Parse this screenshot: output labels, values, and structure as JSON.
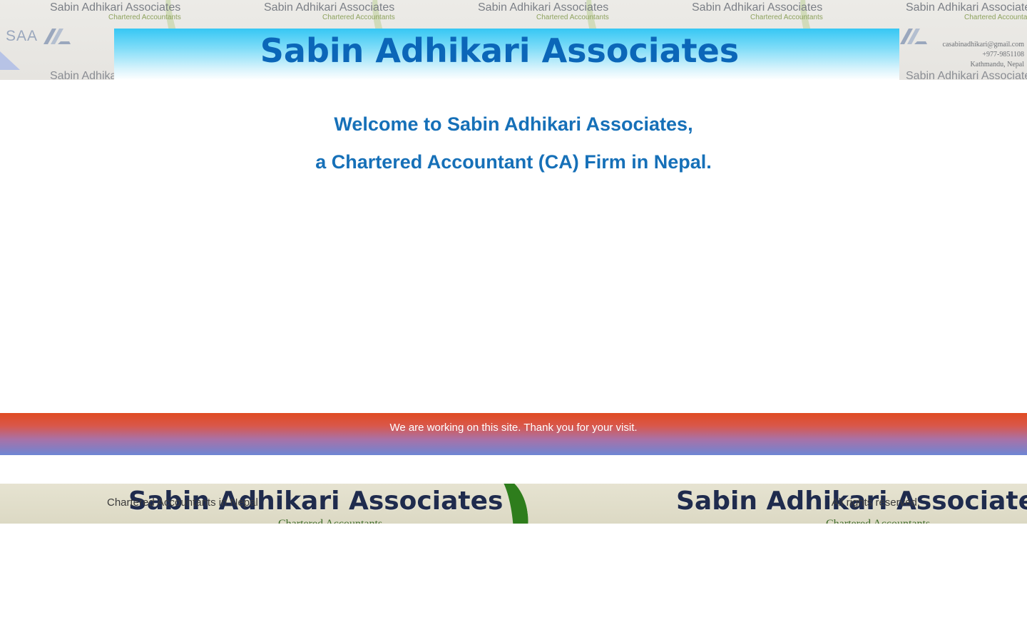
{
  "header": {
    "site_title": "Sabin Adhikari Associates",
    "background_card": {
      "name": "Sabin Adhikari Associates",
      "subtitle": "Chartered Accountants",
      "logo_text": "SAA",
      "email": "casabinadhikari@gmail.com",
      "phone": "+977-9851108",
      "location": "Kathmandu, Nepal"
    }
  },
  "welcome": {
    "line1": "Welcome to Sabin Adhikari Associates,",
    "line2": "a Chartered Accountant (CA) Firm in Nepal."
  },
  "notice": {
    "text": "We are working on this site. Thank you for your visit."
  },
  "footer": {
    "left_text": "Chartered Accountants in Nepal",
    "right_text": "All rights reserved.",
    "background_card": {
      "name": "Sabin Adhikari Associates",
      "subtitle": "Chartered Accountants"
    }
  },
  "colors": {
    "title_blue": "#0b66b8",
    "welcome_blue": "#1670b8",
    "banner_top": "#36c7f4",
    "notice_top": "#e04b22",
    "notice_bottom": "#6d86d4"
  }
}
